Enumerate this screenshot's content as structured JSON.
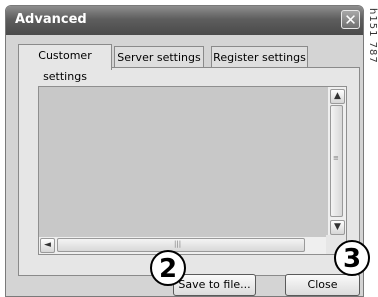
{
  "window": {
    "title": "Advanced",
    "close_glyph": "✕"
  },
  "tabs": [
    {
      "label": "Customer settings",
      "active": true
    },
    {
      "label": "Server settings",
      "active": false
    },
    {
      "label": "Register settings",
      "active": false
    }
  ],
  "scrollbars": {
    "up_glyph": "▲",
    "down_glyph": "▼",
    "left_glyph": "◄",
    "grip_v": "≡",
    "grip_h": "|||"
  },
  "buttons": {
    "save_label": "Save to file...",
    "close_label": "Close"
  },
  "callouts": {
    "save": "2",
    "close": "3"
  },
  "figure_code": "h151 787",
  "colors": {
    "titlebar": "#5e5e5e",
    "dialog_bg": "#d4d4d4",
    "list_bg": "#c8c8c8"
  }
}
